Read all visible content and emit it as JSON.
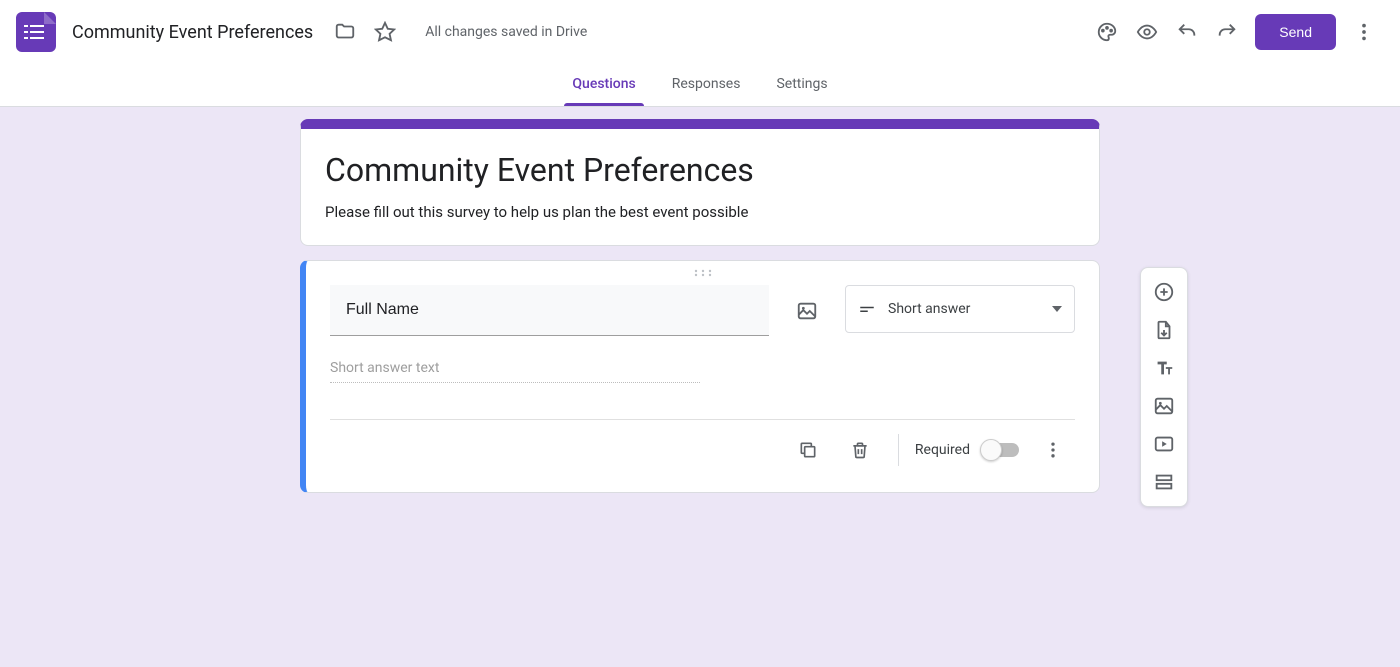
{
  "header": {
    "doc_title": "Community Event Preferences",
    "save_status": "All changes saved in Drive",
    "send_label": "Send"
  },
  "tabs": {
    "questions": "Questions",
    "responses": "Responses",
    "settings": "Settings",
    "active": "questions"
  },
  "form": {
    "title": "Community Event Preferences",
    "description": "Please fill out this survey to help us plan the best event possible"
  },
  "question": {
    "text": "Full Name",
    "type_label": "Short answer",
    "answer_placeholder": "Short answer text",
    "required_label": "Required",
    "required": false
  },
  "side_toolbar": {
    "add_question": "Add question",
    "import_questions": "Import questions",
    "add_title": "Add title and description",
    "add_image": "Add image",
    "add_video": "Add video",
    "add_section": "Add section"
  },
  "colors": {
    "primary": "#673ab7",
    "accent_blue": "#4285f4",
    "canvas_bg": "#ece6f6"
  }
}
